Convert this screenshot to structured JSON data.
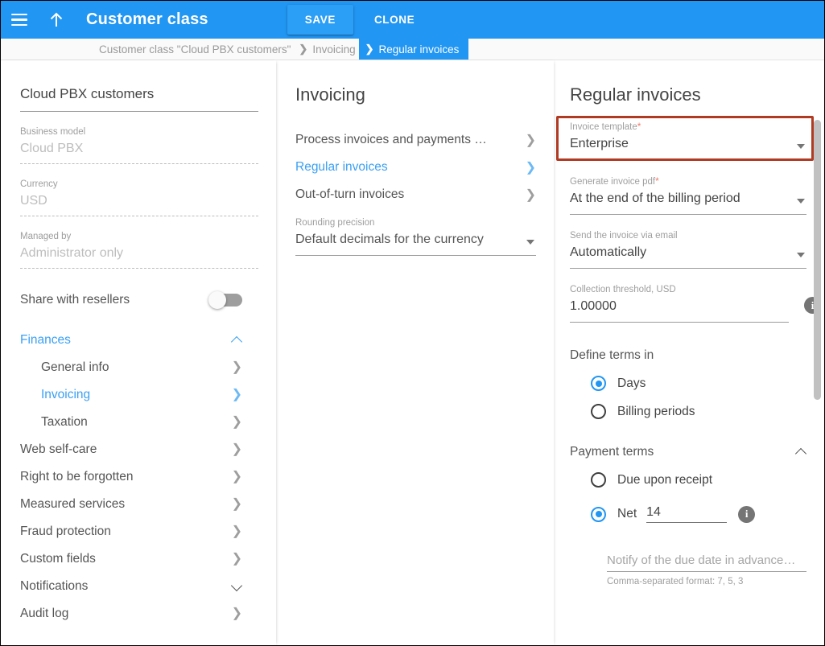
{
  "topbar": {
    "menu_icon": "hamburger-icon",
    "up_icon": "arrow-up-icon",
    "title": "Customer class",
    "save_label": "SAVE",
    "clone_label": "CLONE"
  },
  "breadcrumb": {
    "items": [
      {
        "label": "Customer class \"Cloud PBX customers\"",
        "active": false
      },
      {
        "label": "Invoicing",
        "active": false
      },
      {
        "label": "Regular invoices",
        "active": true
      }
    ]
  },
  "left_panel": {
    "title": "Cloud PBX customers",
    "fields": [
      {
        "label": "Business model",
        "value": "Cloud PBX"
      },
      {
        "label": "Currency",
        "value": "USD"
      },
      {
        "label": "Managed by",
        "value": "Administrator only"
      }
    ],
    "toggle": {
      "label": "Share with resellers",
      "state": "off"
    },
    "nav": [
      {
        "label": "Finances",
        "accent": true,
        "icon": "chevron-up-icon",
        "level": 0
      },
      {
        "label": "General info",
        "accent": false,
        "icon": "chevron-right-icon",
        "level": 1
      },
      {
        "label": "Invoicing",
        "accent": true,
        "icon": "chevron-right-icon",
        "level": 1
      },
      {
        "label": "Taxation",
        "accent": false,
        "icon": "chevron-right-icon",
        "level": 1
      },
      {
        "label": "Web self-care",
        "accent": false,
        "icon": "chevron-right-icon",
        "level": 0
      },
      {
        "label": "Right to be forgotten",
        "accent": false,
        "icon": "chevron-right-icon",
        "level": 0
      },
      {
        "label": "Measured services",
        "accent": false,
        "icon": "chevron-right-icon",
        "level": 0
      },
      {
        "label": "Fraud protection",
        "accent": false,
        "icon": "chevron-right-icon",
        "level": 0
      },
      {
        "label": "Custom fields",
        "accent": false,
        "icon": "chevron-right-icon",
        "level": 0
      },
      {
        "label": "Notifications",
        "accent": false,
        "icon": "chevron-down-icon",
        "level": 0
      },
      {
        "label": "Audit log",
        "accent": false,
        "icon": "chevron-right-icon",
        "level": 0
      }
    ]
  },
  "mid_panel": {
    "title": "Invoicing",
    "items": [
      {
        "label": "Process invoices and payments …",
        "accent": false
      },
      {
        "label": "Regular invoices",
        "accent": true
      },
      {
        "label": "Out-of-turn invoices",
        "accent": false
      }
    ],
    "rounding": {
      "label": "Rounding precision",
      "value": "Default decimals for the currency"
    }
  },
  "right_panel": {
    "title": "Regular invoices",
    "invoice_template": {
      "label": "Invoice template",
      "required": "*",
      "value": "Enterprise"
    },
    "generate_pdf": {
      "label": "Generate invoice pdf",
      "required": "*",
      "value": "At the end of the billing period"
    },
    "send_email": {
      "label": "Send the invoice via email",
      "value": "Automatically"
    },
    "collection_threshold": {
      "label": "Collection threshold, USD",
      "value": "1.00000",
      "info": "i"
    },
    "define_terms": {
      "title": "Define terms in",
      "options": [
        {
          "label": "Days",
          "selected": true
        },
        {
          "label": "Billing periods",
          "selected": false
        }
      ]
    },
    "payment_terms": {
      "title": "Payment terms",
      "collapse_icon": "chevron-up-icon",
      "options": [
        {
          "label": "Due upon receipt",
          "selected": false
        },
        {
          "label": "Net",
          "selected": true,
          "value": "14",
          "info": "i"
        }
      ],
      "notify": {
        "placeholder": "Notify of the due date in advance…",
        "hint": "Comma-separated format: 7, 5, 3"
      }
    }
  },
  "colors": {
    "accent": "#2196f3",
    "link": "#3aa0f3",
    "highlight": "#b03a22",
    "required": "#ef7b6a"
  }
}
